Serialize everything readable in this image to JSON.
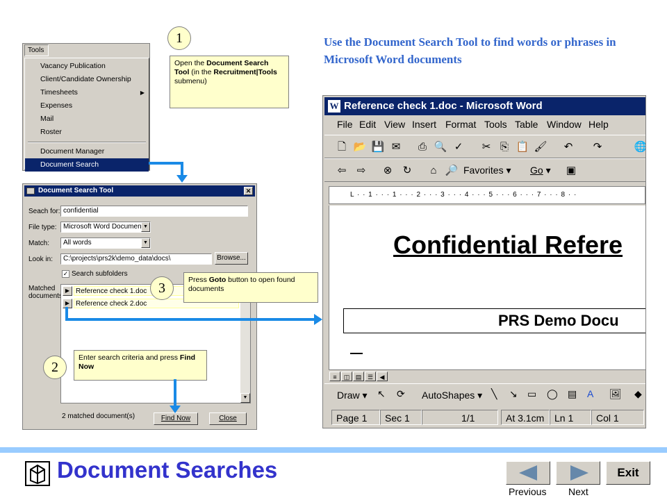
{
  "tools_menu": {
    "menubar_label": "Tools",
    "items": [
      {
        "label": "Vacancy Publication"
      },
      {
        "label": "Client/Candidate Ownership"
      },
      {
        "label": "Timesheets"
      },
      {
        "label": "Expenses"
      },
      {
        "label": "Mail"
      },
      {
        "label": "Roster"
      },
      {
        "label": "Document Manager"
      },
      {
        "label": "Document Search"
      }
    ]
  },
  "callouts": {
    "step1_number": "1",
    "step1_text_a": "Open the ",
    "step1_text_b": "Document Search Tool",
    "step1_text_c": " (in the ",
    "step1_text_d": "Recruitment|Tools",
    "step1_text_e": " submenu)",
    "step2_number": "2",
    "step2_text_a": "Enter search criteria and press ",
    "step2_text_b": "Find Now",
    "step3_number": "3",
    "step3_text_a": "Press ",
    "step3_text_b": "Goto",
    "step3_text_c": " button to open found documents"
  },
  "headline": "Use the Document Search Tool to find words or phrases in Microsoft Word documents",
  "dialog": {
    "title": "Document Search Tool",
    "close_glyph": "✕",
    "search_label": "Seach for:",
    "search_value": "confidential",
    "filetype_label": "File type:",
    "filetype_value": "Microsoft Word Documents",
    "match_label": "Match:",
    "match_value": "All words",
    "lookin_label": "Look in:",
    "lookin_value": "C:\\projects\\prs2k\\demo_data\\docs\\",
    "browse_label": "Browse...",
    "subfolders_label": "Search subfolders",
    "matched_label": "Matched documents",
    "results": [
      "Reference check 1.doc",
      "Reference check 2.doc"
    ],
    "status": "2 matched document(s)",
    "find_label": "Find Now",
    "close_label": "Close"
  },
  "word": {
    "title": "Reference check 1.doc - Microsoft Word",
    "menu": [
      "File",
      "Edit",
      "View",
      "Insert",
      "Format",
      "Tools",
      "Table",
      "Window",
      "Help"
    ],
    "favorites_label": "Favorites",
    "go_label": "Go",
    "ruler": "L · · 1 · · · 1 · · · 2 · · · 3 · · · 4 · · · 5 · · · 6 · · · 7 · · · 8 · ·",
    "doc_heading": "Confidential Refere",
    "doc_box_text": "PRS Demo Docu",
    "draw_label": "Draw",
    "autoshapes_label": "AutoShapes",
    "status": {
      "page": "Page 1",
      "sec": "Sec 1",
      "pages": "1/1",
      "at": "At 3.1cm",
      "ln": "Ln 1",
      "col": "Col 1"
    }
  },
  "footer": {
    "page_title": "Document Searches",
    "previous_label": "Previous",
    "next_label": "Next",
    "exit_label": "Exit"
  },
  "colors": {
    "accent_blue": "#3366cc",
    "title_blue": "#3333cc",
    "arrow_blue": "#1a8ae6",
    "callout_yellow": "#ffffcc",
    "selection_navy": "#0a246a"
  }
}
